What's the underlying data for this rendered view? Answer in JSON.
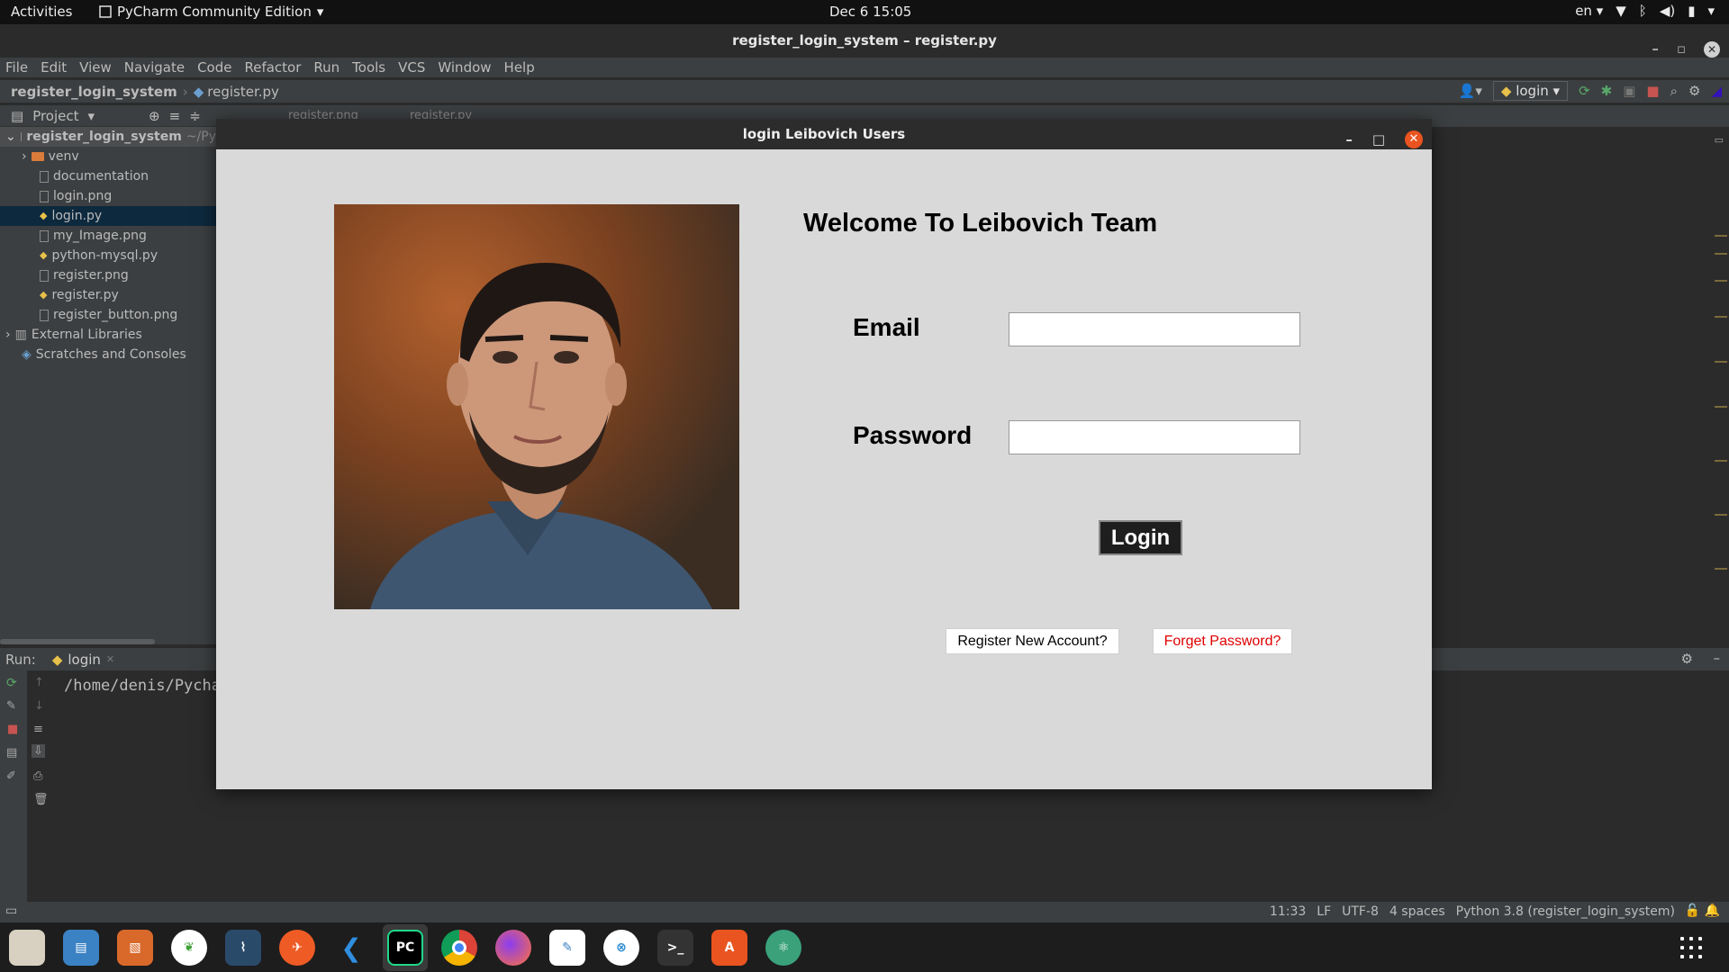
{
  "topbar": {
    "activities": "Activities",
    "app_name": "PyCharm Community Edition",
    "clock": "Dec 6  15:05",
    "lang": "en"
  },
  "window": {
    "title": "register_login_system – register.py"
  },
  "menu": [
    "File",
    "Edit",
    "View",
    "Navigate",
    "Code",
    "Refactor",
    "Run",
    "Tools",
    "VCS",
    "Window",
    "Help"
  ],
  "navbar": {
    "project": "register_login_system",
    "file": "register.py",
    "run_config": "login"
  },
  "project_panel": {
    "title": "Project",
    "root": "register_login_system",
    "root_path": "~/Py",
    "items": [
      {
        "label": "venv",
        "kind": "folder"
      },
      {
        "label": "documentation",
        "kind": "file"
      },
      {
        "label": "login.png",
        "kind": "file"
      },
      {
        "label": "login.py",
        "kind": "py",
        "selected": true
      },
      {
        "label": "my_Image.png",
        "kind": "file"
      },
      {
        "label": "python-mysql.py",
        "kind": "py"
      },
      {
        "label": "register.png",
        "kind": "file"
      },
      {
        "label": "register.py",
        "kind": "py"
      },
      {
        "label": "register_button.png",
        "kind": "file"
      }
    ],
    "external": "External Libraries",
    "scratches": "Scratches and Consoles"
  },
  "editor_tabs": [
    "register.png",
    "register.py"
  ],
  "run_panel": {
    "label": "Run:",
    "tab": "login",
    "console_line": "/home/denis/Pycha"
  },
  "statusbar": {
    "items": [
      "11:33",
      "LF",
      "UTF-8",
      "4 spaces",
      "Python 3.8 (register_login_system)"
    ]
  },
  "login_window": {
    "title": "login Leibovich Users",
    "welcome": "Welcome To Leibovich Team",
    "email_label": "Email",
    "email_value": "",
    "password_label": "Password",
    "password_value": "",
    "login_button": "Login",
    "register_link": "Register New Account?",
    "forgot_link": "Forget Password?",
    "forgot_color": "#e00000"
  },
  "dock": {
    "apps": [
      "files-icon",
      "writer-icon",
      "impress-icon",
      "mongodb-icon",
      "mysql-workbench-icon",
      "postman-icon",
      "vscode-icon",
      "pycharm-icon",
      "chrome-icon",
      "firefox-icon",
      "text-editor-icon",
      "remote-desktop-icon",
      "terminal-icon",
      "software-center-icon",
      "atom-icon"
    ],
    "active": "pycharm-icon"
  }
}
